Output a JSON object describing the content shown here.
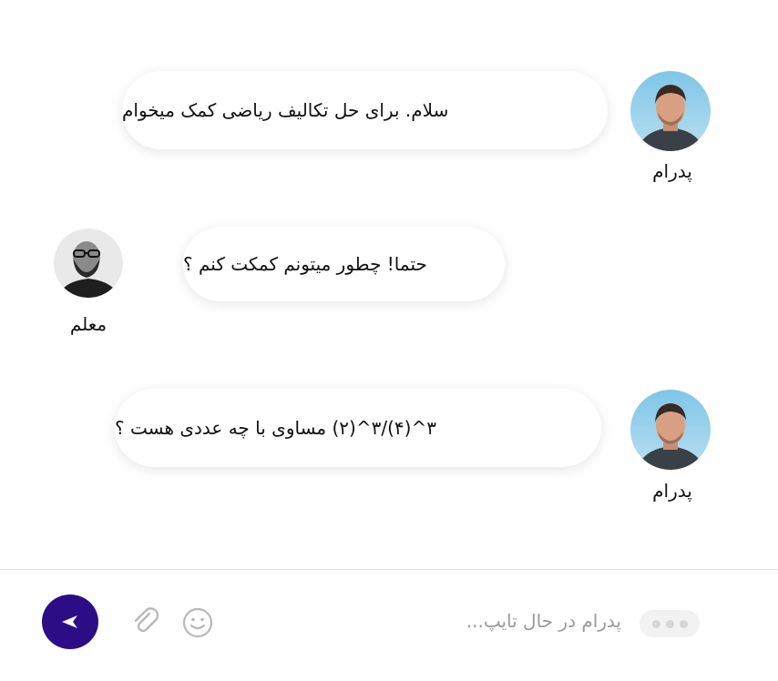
{
  "messages": [
    {
      "sender": "پدرام",
      "side": "right",
      "text": "سلام. برای حل تکالیف ریاضی کمک میخوام",
      "avatar": "user-avatar"
    },
    {
      "sender": "معلم",
      "side": "left",
      "text": "حتما! چطور میتونم کمکت کنم ؟",
      "avatar": "teacher-avatar"
    },
    {
      "sender": "پدرام",
      "side": "right",
      "text": "۳^(۴)/۳^(۲) مساوی با چه عددی هست ؟",
      "avatar": "user-avatar"
    }
  ],
  "composer": {
    "typing_status": "پدرام در حال تایپ...",
    "send_icon": "send-icon",
    "attach_icon": "paperclip-icon",
    "emoji_icon": "smiley-icon"
  },
  "colors": {
    "accent": "#2c0d86",
    "bubble": "#ffffff",
    "muted_text": "#9a9a9a"
  }
}
